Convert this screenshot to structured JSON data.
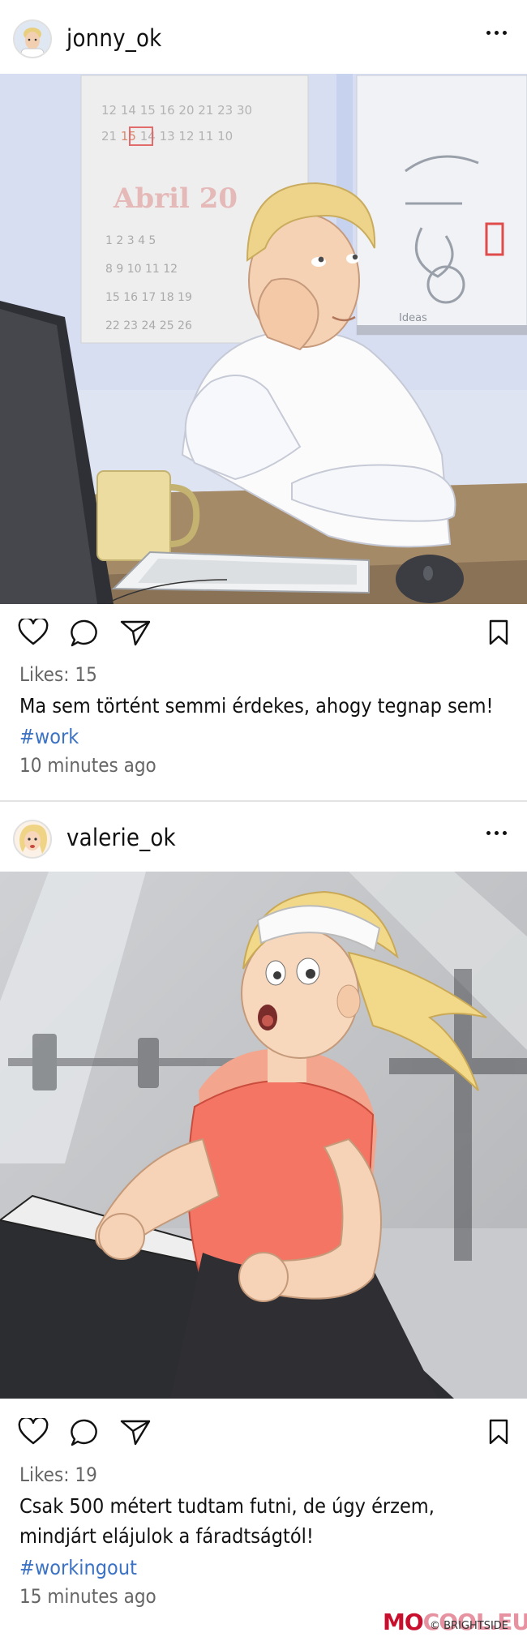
{
  "posts": [
    {
      "username": "jonny_ok",
      "likes": "Likes: 15",
      "caption": "Ma sem történt semmi érdekes, ahogy tegnap sem!",
      "hashtag": "#work",
      "time": "10 minutes ago",
      "image_text": {
        "calendar_month": "Abril 20",
        "calendar_numbers": [
          "12",
          "14",
          "15",
          "16",
          "20",
          "21",
          "23",
          "30"
        ],
        "board_note": "Ideas"
      }
    },
    {
      "username": "valerie_ok",
      "likes": "Likes: 19",
      "caption": "Csak 500 métert tudtam futni, de úgy érzem, mindjárt elájulok a fáradtságtól!",
      "hashtag": "#workingout",
      "time": "15 minutes ago"
    }
  ],
  "watermark": {
    "brand_strong": "MO",
    "brand_rest": "COOL.EU",
    "credit": "© BRIGHTSIDE"
  },
  "icons": [
    "heart-icon",
    "comment-icon",
    "share-icon",
    "bookmark-icon",
    "more-options-icon"
  ],
  "colors": {
    "hashtag": "#3b72c4",
    "meta_text": "#666666",
    "watermark": "#c8102e"
  }
}
